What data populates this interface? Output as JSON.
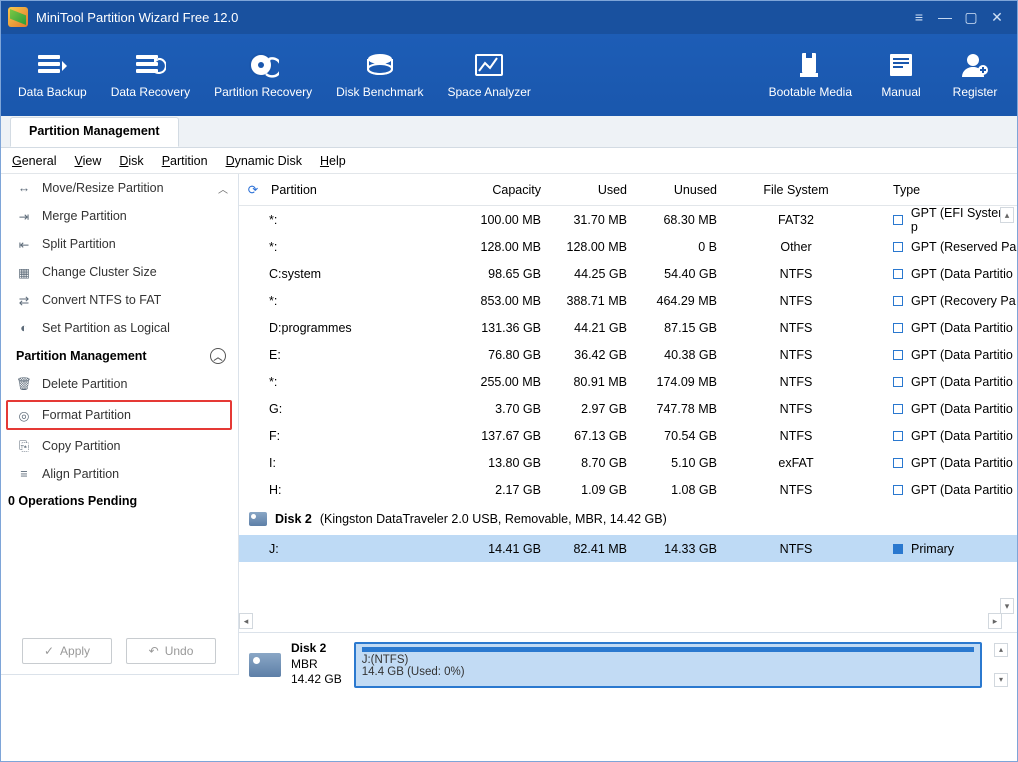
{
  "title": "MiniTool Partition Wizard Free 12.0",
  "toolbar": [
    {
      "label": "Data Backup",
      "icon": "backup"
    },
    {
      "label": "Data Recovery",
      "icon": "recovery"
    },
    {
      "label": "Partition Recovery",
      "icon": "part-recovery"
    },
    {
      "label": "Disk Benchmark",
      "icon": "benchmark"
    },
    {
      "label": "Space Analyzer",
      "icon": "analyzer"
    }
  ],
  "toolbar_right": [
    {
      "label": "Bootable Media",
      "icon": "bootable"
    },
    {
      "label": "Manual",
      "icon": "manual"
    },
    {
      "label": "Register",
      "icon": "register"
    }
  ],
  "tab": "Partition Management",
  "menus": [
    "General",
    "View",
    "Disk",
    "Partition",
    "Dynamic Disk",
    "Help"
  ],
  "sidebar_top": [
    {
      "label": "Move/Resize Partition",
      "icon": "↔"
    },
    {
      "label": "Merge Partition",
      "icon": "⇥"
    },
    {
      "label": "Split Partition",
      "icon": "⇤"
    },
    {
      "label": "Change Cluster Size",
      "icon": "▦"
    },
    {
      "label": "Convert NTFS to FAT",
      "icon": "⇄"
    },
    {
      "label": "Set Partition as Logical",
      "icon": "◐"
    }
  ],
  "sidebar_header": "Partition Management",
  "sidebar_group": [
    {
      "label": "Delete Partition",
      "icon": "🗑",
      "hi": false
    },
    {
      "label": "Format Partition",
      "icon": "◎",
      "hi": true
    },
    {
      "label": "Copy Partition",
      "icon": "⎘",
      "hi": false
    },
    {
      "label": "Align Partition",
      "icon": "≡",
      "hi": false
    }
  ],
  "ops_pending": "0 Operations Pending",
  "apply": "Apply",
  "undo": "Undo",
  "columns": {
    "partition": "Partition",
    "capacity": "Capacity",
    "used": "Used",
    "unused": "Unused",
    "fs": "File System",
    "type": "Type"
  },
  "rows": [
    {
      "p": "*:",
      "cap": "100.00 MB",
      "used": "31.70 MB",
      "un": "68.30 MB",
      "fs": "FAT32",
      "type": "GPT (EFI System p"
    },
    {
      "p": "*:",
      "cap": "128.00 MB",
      "used": "128.00 MB",
      "un": "0 B",
      "fs": "Other",
      "type": "GPT (Reserved Pa"
    },
    {
      "p": "C:system",
      "cap": "98.65 GB",
      "used": "44.25 GB",
      "un": "54.40 GB",
      "fs": "NTFS",
      "type": "GPT (Data Partitio"
    },
    {
      "p": "*:",
      "cap": "853.00 MB",
      "used": "388.71 MB",
      "un": "464.29 MB",
      "fs": "NTFS",
      "type": "GPT (Recovery Pa"
    },
    {
      "p": "D:programmes",
      "cap": "131.36 GB",
      "used": "44.21 GB",
      "un": "87.15 GB",
      "fs": "NTFS",
      "type": "GPT (Data Partitio"
    },
    {
      "p": "E:",
      "cap": "76.80 GB",
      "used": "36.42 GB",
      "un": "40.38 GB",
      "fs": "NTFS",
      "type": "GPT (Data Partitio"
    },
    {
      "p": "*:",
      "cap": "255.00 MB",
      "used": "80.91 MB",
      "un": "174.09 MB",
      "fs": "NTFS",
      "type": "GPT (Data Partitio"
    },
    {
      "p": "G:",
      "cap": "3.70 GB",
      "used": "2.97 GB",
      "un": "747.78 MB",
      "fs": "NTFS",
      "type": "GPT (Data Partitio"
    },
    {
      "p": "F:",
      "cap": "137.67 GB",
      "used": "67.13 GB",
      "un": "70.54 GB",
      "fs": "NTFS",
      "type": "GPT (Data Partitio"
    },
    {
      "p": "I:",
      "cap": "13.80 GB",
      "used": "8.70 GB",
      "un": "5.10 GB",
      "fs": "exFAT",
      "type": "GPT (Data Partitio"
    },
    {
      "p": "H:",
      "cap": "2.17 GB",
      "used": "1.09 GB",
      "un": "1.08 GB",
      "fs": "NTFS",
      "type": "GPT (Data Partitio"
    }
  ],
  "disk2_label": "Disk 2",
  "disk2_desc": "(Kingston DataTraveler 2.0 USB, Removable, MBR, 14.42 GB)",
  "disk2_rows": [
    {
      "p": "J:",
      "cap": "14.41 GB",
      "used": "82.41 MB",
      "un": "14.33 GB",
      "fs": "NTFS",
      "type": "Primary",
      "sel": true,
      "fill": true
    }
  ],
  "dm": {
    "name": "Disk 2",
    "scheme": "MBR",
    "size": "14.42 GB",
    "label": "J:(NTFS)",
    "sub": "14.4 GB (Used: 0%)"
  }
}
